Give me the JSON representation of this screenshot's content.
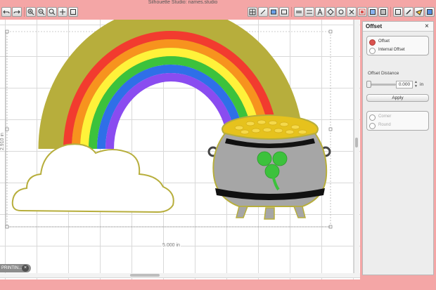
{
  "window": {
    "title": "Silhouette Studio: names.studio"
  },
  "toolbar": {
    "icons": [
      "undo-icon",
      "redo-icon",
      "zoom-in-icon",
      "zoom-out-icon",
      "zoom-select-icon",
      "pan-icon",
      "fit-page-icon",
      "grid-icon",
      "draw-icon",
      "align-icon",
      "group-icon",
      "text-icon",
      "ungroup-icon",
      "transform-icon",
      "replicate-icon",
      "modify-icon",
      "offset-icon",
      "trace-icon",
      "fill-icon",
      "line-icon",
      "knife-icon",
      "eraser-icon",
      "send-icon"
    ]
  },
  "canvas": {
    "dim_width": "5.000 in",
    "dim_height": "2.910 in",
    "colors": {
      "red": "#f23b2f",
      "orange": "#f7931e",
      "yellow": "#fff23a",
      "green": "#3cc23c",
      "blue": "#2f6fe8",
      "purple": "#8a4cf0",
      "pot": "#9e9e9e",
      "gold": "#e6c21d",
      "outline": "#b7ae3c"
    }
  },
  "doc_tab": {
    "label": "PRINTIN...",
    "close": "×"
  },
  "panel": {
    "title": "Offset",
    "close": "×",
    "options": [
      {
        "label": "Offset",
        "active": true
      },
      {
        "label": "Internal Offset",
        "active": false
      }
    ],
    "distance_label": "Offset Distance",
    "distance_value": "0.000",
    "stepper_up": "▲",
    "stepper_down": "▼",
    "unit": "in",
    "apply": "Apply",
    "corner_options": [
      {
        "label": "Corner"
      },
      {
        "label": "Round"
      }
    ]
  }
}
